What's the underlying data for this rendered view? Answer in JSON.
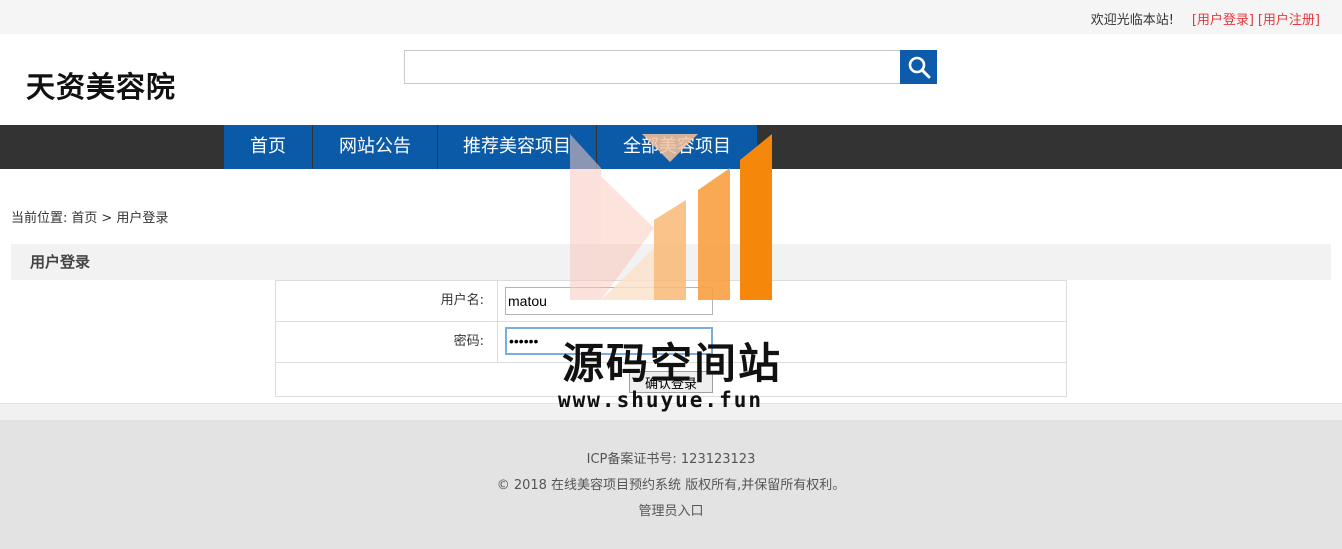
{
  "topbar": {
    "welcome": "欢迎光临本站!",
    "login_link": "[用户登录]",
    "register_link": "[用户注册]"
  },
  "header": {
    "logo_text": "天资美容院",
    "search": {
      "value": "",
      "placeholder": "",
      "icon": "search-icon"
    }
  },
  "nav": {
    "items": [
      "首页",
      "网站公告",
      "推荐美容项目",
      "全部美容项目"
    ]
  },
  "breadcrumb": {
    "prefix": "当前位置:",
    "home": "首页",
    "separator": ">",
    "current": "用户登录"
  },
  "section": {
    "title": "用户登录"
  },
  "form": {
    "username_label": "用户名:",
    "username_value": "matou",
    "password_label": "密码:",
    "password_value": "••••••",
    "submit_label": "确认登录"
  },
  "footer": {
    "icp": "ICP备案证书号: 123123123",
    "copyright": "© 2018 在线美容项目预约系统 版权所有,并保留所有权利。",
    "admin_link": "管理员入口"
  },
  "watermark": {
    "title": "源码空间站",
    "url": "www.shuyue.fun"
  },
  "colors": {
    "nav_bg": "#333333",
    "nav_item_bg": "#0b5aa8",
    "search_btn": "#0e5bab",
    "link_red": "#e4393c",
    "footer_bg": "#e3e3e3",
    "watermark_orange": "#f5870a"
  }
}
